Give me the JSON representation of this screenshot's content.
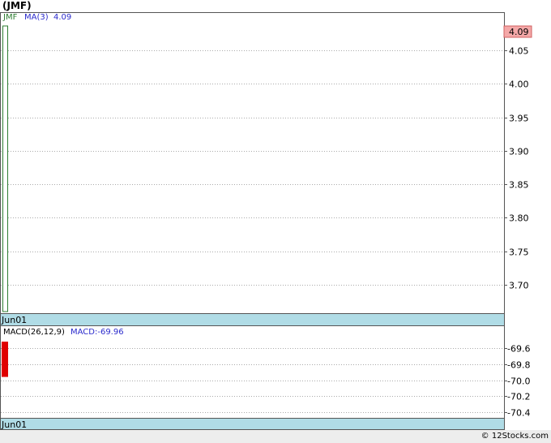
{
  "title": "(JMF)",
  "footer": {
    "credit": "© 12Stocks.com"
  },
  "chart_data": [
    {
      "type": "candlestick",
      "panel": "price",
      "legend": {
        "symbol": "JMF",
        "ma_label": "MA(3)",
        "ma_value": "4.09"
      },
      "x": [
        "Jun01"
      ],
      "open": [
        4.09
      ],
      "close": [
        4.09
      ],
      "high": [
        4.09
      ],
      "low": [
        3.66
      ],
      "yticks": [
        4.05,
        4.0,
        3.95,
        3.9,
        3.85,
        3.8,
        3.75,
        3.7
      ],
      "ytick_labels": [
        "4.05",
        "4.00",
        "3.95",
        "3.90",
        "3.85",
        "3.80",
        "3.75",
        "3.70"
      ],
      "ylim": [
        3.66,
        4.09
      ],
      "last_price": "4.09",
      "x_label": "Jun01",
      "colors": {
        "candle": "#2e7d32",
        "ma": "#2b2bcc",
        "badge_bg": "#f4a8a8",
        "grid": "#aaaaaa",
        "axis_band": "#b0dce6"
      }
    },
    {
      "type": "bar",
      "panel": "macd",
      "legend": {
        "label": "MACD(26,12,9)",
        "value_label": "MACD:-69.96"
      },
      "x": [
        "Jun01"
      ],
      "values": [
        -69.96
      ],
      "bar_top": -69.52,
      "yticks": [
        -69.6,
        -69.8,
        -70.0,
        -70.2,
        -70.4
      ],
      "ytick_labels": [
        "-69.6",
        "-69.8",
        "-70.0",
        "-70.2",
        "-70.4"
      ],
      "ylim": [
        -70.44,
        -69.4
      ],
      "x_label": "Jun01",
      "colors": {
        "bar": "#e00000",
        "label": "#000000",
        "value": "#2b2bcc"
      }
    }
  ]
}
